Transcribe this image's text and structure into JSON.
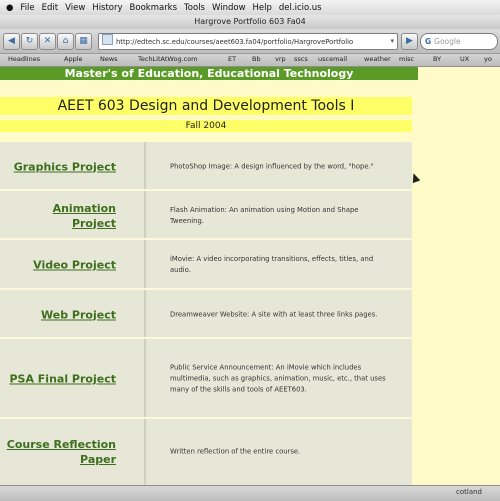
{
  "menubar": {
    "items": [
      "File",
      "Edit",
      "View",
      "History",
      "Bookmarks",
      "Tools",
      "Window",
      "Help",
      "del.icio.us"
    ]
  },
  "window": {
    "title": "Hargrove Portfolio 603 Fa04"
  },
  "toolbar": {
    "url": "http://edtech.sc.edu/courses/aeet603.fa04/portfolio/HargrovePortfolio",
    "search_placeholder": "Google"
  },
  "bookmarks": [
    "Headlines",
    "Apple",
    "News",
    "TechLitAtWog.com",
    "ET",
    "Bb",
    "vrp",
    "sscs",
    "uscemail",
    "weather",
    "misc",
    "BY",
    "UX",
    "yo"
  ],
  "page": {
    "banner": "Master's of Education, Educational Technology",
    "course_title": "AEET 603 Design and Development Tools I",
    "term": "Fall 2004"
  },
  "projects": [
    {
      "name": "Graphics Project",
      "description": "PhotoShop Image: A design influenced by the word, \"hope.\""
    },
    {
      "name": "Animation Project",
      "description": "Flash Animation: An animation using Motion and Shape Tweening."
    },
    {
      "name": "Video Project",
      "description": "iMovie: A video incorporating transitions, effects, titles, and audio."
    },
    {
      "name": "Web Project",
      "description": "Dreamweaver Website: A site with at least three links pages."
    },
    {
      "name": "PSA Final Project",
      "description": "Public Service Announcement: An iMovie which includes multimedia, such as graphics, animation, music, etc., that uses many of the skills and tools of AEET603."
    },
    {
      "name": "Course Reflection Paper",
      "description": "Written reflection of the entire course."
    }
  ],
  "status": {
    "text": "cotland"
  }
}
